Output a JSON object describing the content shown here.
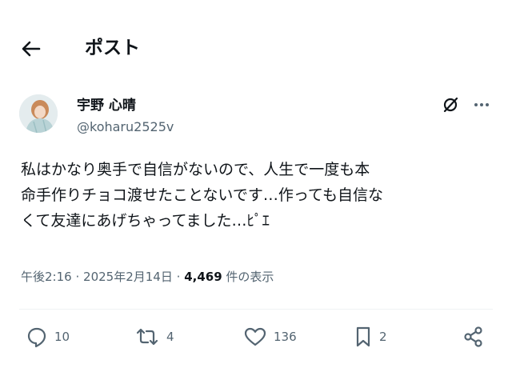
{
  "header": {
    "title": "ポスト",
    "back_icon": "arrow-left-icon"
  },
  "author": {
    "display_name": "宇野 心晴",
    "handle": "@koharu2525v"
  },
  "tweet": {
    "lines": [
      "私はかなり奥手で自信がないので、人生で一度も本",
      "命手作りチョコ渡せたことないです…作っても自信な",
      "くて友達にあげちゃってました…ﾋﾟｴ"
    ]
  },
  "meta": {
    "time": "午後2:16",
    "date": "2025年2月14日",
    "views_count": "4,469",
    "views_label": "件の表示",
    "separator": "·"
  },
  "actions": {
    "replies": "10",
    "reposts": "4",
    "likes": "136",
    "bookmarks": "2"
  },
  "colors": {
    "text": "#0f1419",
    "secondary": "#536471",
    "divider": "#eff3f4"
  }
}
